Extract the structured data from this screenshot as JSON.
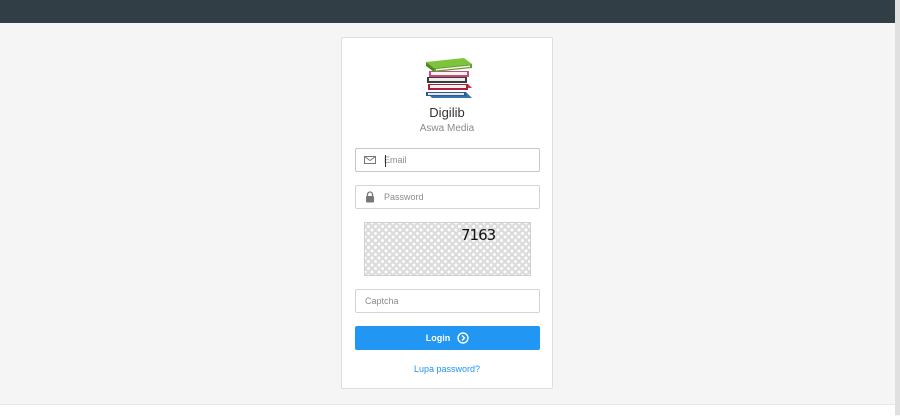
{
  "app": {
    "title": "Digilib",
    "subtitle": "Aswa Media",
    "logo_icon": "book-stack-icon"
  },
  "form": {
    "email": {
      "placeholder": "Email",
      "value": "",
      "icon": "envelope-icon"
    },
    "password": {
      "placeholder": "Password",
      "value": "",
      "icon": "lock-icon"
    },
    "captcha_code": "7163",
    "captcha": {
      "placeholder": "Captcha",
      "value": ""
    },
    "login_label": "Login",
    "login_icon": "chevron-circle-right-icon",
    "forgot_label": "Lupa password?"
  },
  "colors": {
    "topbar": "#323e46",
    "accent": "#2196f3",
    "background": "#f5f5f5"
  }
}
